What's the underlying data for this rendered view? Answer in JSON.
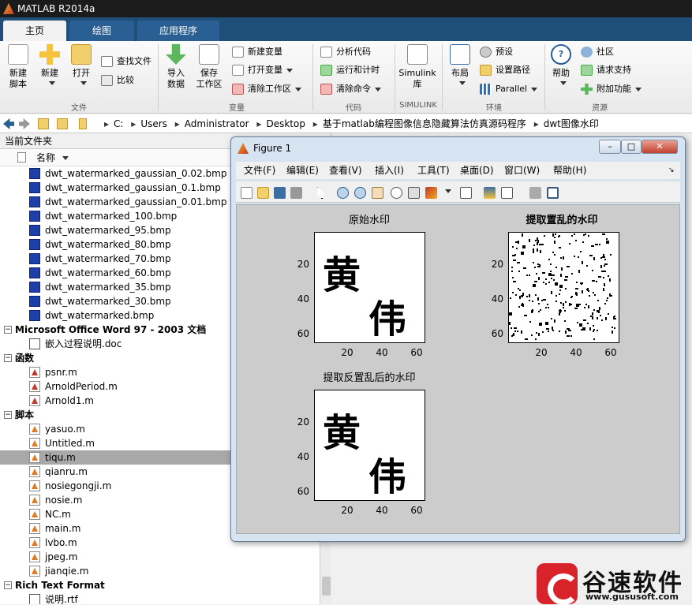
{
  "window": {
    "title": "MATLAB R2014a"
  },
  "tabs": [
    {
      "label": "主页",
      "active": true
    },
    {
      "label": "绘图",
      "active": false
    },
    {
      "label": "应用程序",
      "active": false
    }
  ],
  "ribbon": {
    "file": {
      "section": "文件",
      "new_script": "新建\n脚本",
      "new": "新建",
      "open": "打开",
      "find_files": "查找文件",
      "compare": "比较"
    },
    "variable": {
      "section": "变量",
      "import": "导入\n数据",
      "save_workspace": "保存\n工作区",
      "new_variable": "新建变量",
      "open_variable": "打开变量",
      "clear_workspace": "清除工作区"
    },
    "code": {
      "section": "代码",
      "analyze": "分析代码",
      "run_time": "运行和计时",
      "clear_commands": "清除命令"
    },
    "simulink": {
      "section": "SIMULINK",
      "library": "Simulink\n库"
    },
    "environment": {
      "section": "环境",
      "layout": "布局",
      "preferences": "预设",
      "set_path": "设置路径",
      "parallel": "Parallel"
    },
    "resources": {
      "section": "资源",
      "help": "帮助",
      "community": "社区",
      "request_support": "请求支持",
      "addons": "附加功能"
    }
  },
  "path": {
    "segments": [
      "C:",
      "Users",
      "Administrator",
      "Desktop",
      "基于matlab编程图像信息隐藏算法仿真源码程序",
      "dwt图像水印"
    ]
  },
  "current_folder": {
    "title": "当前文件夹",
    "col_name": "名称",
    "rows": [
      {
        "type": "file",
        "icon": "bmp",
        "label": "dwt_watermarked_gaussian_0.02.bmp"
      },
      {
        "type": "file",
        "icon": "bmp",
        "label": "dwt_watermarked_gaussian_0.1.bmp"
      },
      {
        "type": "file",
        "icon": "bmp",
        "label": "dwt_watermarked_gaussian_0.01.bmp"
      },
      {
        "type": "file",
        "icon": "bmp",
        "label": "dwt_watermarked_100.bmp"
      },
      {
        "type": "file",
        "icon": "bmp",
        "label": "dwt_watermarked_95.bmp"
      },
      {
        "type": "file",
        "icon": "bmp",
        "label": "dwt_watermarked_80.bmp"
      },
      {
        "type": "file",
        "icon": "bmp",
        "label": "dwt_watermarked_70.bmp"
      },
      {
        "type": "file",
        "icon": "bmp",
        "label": "dwt_watermarked_60.bmp"
      },
      {
        "type": "file",
        "icon": "bmp",
        "label": "dwt_watermarked_35.bmp"
      },
      {
        "type": "file",
        "icon": "bmp",
        "label": "dwt_watermarked_30.bmp"
      },
      {
        "type": "file",
        "icon": "bmp",
        "label": "dwt_watermarked.bmp"
      },
      {
        "type": "group",
        "label": "Microsoft Office Word 97 - 2003 文档"
      },
      {
        "type": "file",
        "icon": "doc",
        "label": "嵌入过程说明.doc"
      },
      {
        "type": "group",
        "label": "函数"
      },
      {
        "type": "file",
        "icon": "fn",
        "label": "psnr.m"
      },
      {
        "type": "file",
        "icon": "fn",
        "label": "ArnoldPeriod.m"
      },
      {
        "type": "file",
        "icon": "fn",
        "label": "Arnold1.m"
      },
      {
        "type": "group",
        "label": "脚本"
      },
      {
        "type": "file",
        "icon": "m",
        "label": "yasuo.m"
      },
      {
        "type": "file",
        "icon": "m",
        "label": "Untitled.m"
      },
      {
        "type": "file",
        "icon": "m",
        "label": "tiqu.m",
        "selected": true
      },
      {
        "type": "file",
        "icon": "m",
        "label": "qianru.m"
      },
      {
        "type": "file",
        "icon": "m",
        "label": "nosiegongji.m"
      },
      {
        "type": "file",
        "icon": "m",
        "label": "nosie.m"
      },
      {
        "type": "file",
        "icon": "m",
        "label": "NC.m"
      },
      {
        "type": "file",
        "icon": "m",
        "label": "main.m"
      },
      {
        "type": "file",
        "icon": "m",
        "label": "lvbo.m"
      },
      {
        "type": "file",
        "icon": "m",
        "label": "jpeg.m"
      },
      {
        "type": "file",
        "icon": "m",
        "label": "jianqie.m"
      },
      {
        "type": "group",
        "label": "Rich Text Format"
      },
      {
        "type": "file",
        "icon": "doc",
        "label": "说明.rtf"
      }
    ]
  },
  "figure": {
    "title": "Figure 1",
    "menu": [
      "文件(F)",
      "编辑(E)",
      "查看(V)",
      "插入(I)",
      "工具(T)",
      "桌面(D)",
      "窗口(W)",
      "帮助(H)"
    ],
    "axes": [
      {
        "title": "原始水印",
        "bold": false,
        "kind": "glyphs",
        "glyph1": "黄",
        "glyph2": "伟",
        "yticks": [
          "20",
          "40",
          "60"
        ],
        "xticks": [
          "20",
          "40",
          "60"
        ]
      },
      {
        "title": "提取置乱的水印",
        "bold": true,
        "kind": "noise",
        "yticks": [
          "20",
          "40",
          "60"
        ],
        "xticks": [
          "20",
          "40",
          "60"
        ]
      },
      {
        "title": "提取反置乱后的水印",
        "bold": false,
        "kind": "glyphs",
        "glyph1": "黄",
        "glyph2": "伟",
        "yticks": [
          "20",
          "40",
          "60"
        ],
        "xticks": [
          "20",
          "40",
          "60"
        ]
      }
    ]
  },
  "brand": {
    "name": "谷速软件",
    "url": "www.gususoft.com"
  }
}
